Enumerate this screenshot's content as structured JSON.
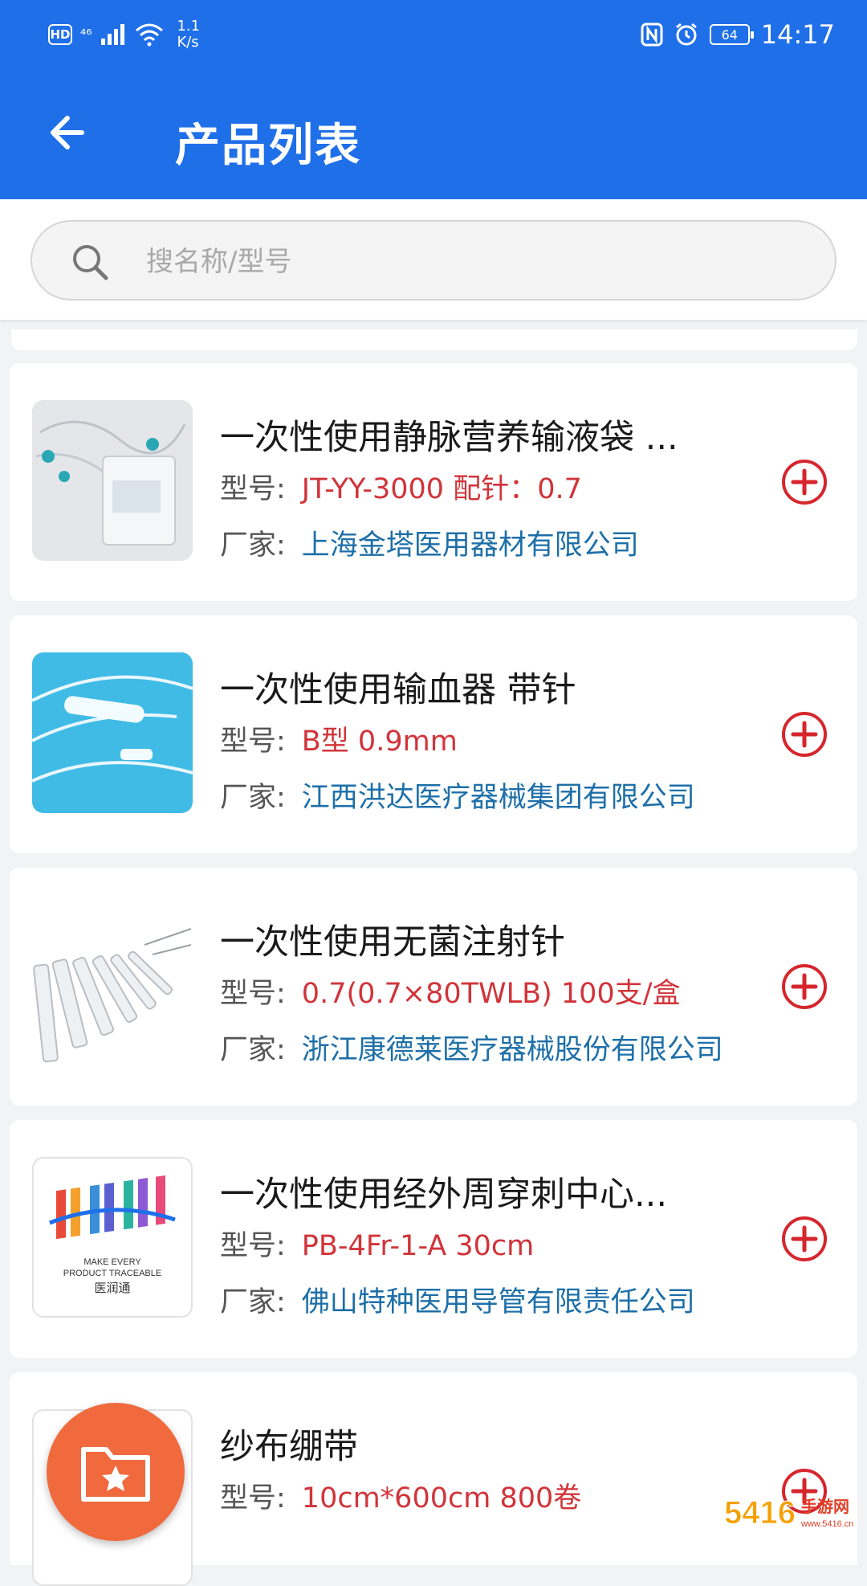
{
  "status_bar": {
    "hd": "HD",
    "network": "⁴⁶",
    "speed_value": "1.1",
    "speed_unit": "K/s",
    "battery": "64",
    "time": "14:17"
  },
  "header": {
    "title": "产品列表"
  },
  "search": {
    "placeholder": "搜名称/型号",
    "value": ""
  },
  "labels": {
    "model": "型号:",
    "maker": "厂家:"
  },
  "products": [
    {
      "name": "一次性使用静脉营养输液袋 ...",
      "model": "JT-YY-3000 配针：0.7",
      "maker": "上海金塔医用器材有限公司"
    },
    {
      "name": "一次性使用输血器 带针",
      "model": "B型 0.9mm",
      "maker": "江西洪达医疗器械集团有限公司"
    },
    {
      "name": "一次性使用无菌注射针",
      "model": "0.7(0.7×80TWLB) 100支/盒",
      "maker": "浙江康德莱医疗器械股份有限公司"
    },
    {
      "name": "一次性使用经外周穿刺中心...",
      "model": "PB-4Fr-1-A 30cm",
      "maker": "佛山特种医用导管有限责任公司"
    },
    {
      "name": "纱布绷带",
      "model": "10cm*600cm 800卷",
      "maker": ""
    }
  ],
  "logo_text": {
    "line1": "MAKE EVERY",
    "line2": "PRODUCT TRACEABLE",
    "brand": "医润通"
  },
  "watermark": {
    "num": "5416",
    "text": "手游网",
    "sub": "www.5416.cn"
  },
  "colors": {
    "primary": "#1f6fe9",
    "model_value": "#d1343a",
    "maker_value": "#1d6fa8",
    "add_icon": "#d6262d",
    "fab": "#f06a3e"
  }
}
